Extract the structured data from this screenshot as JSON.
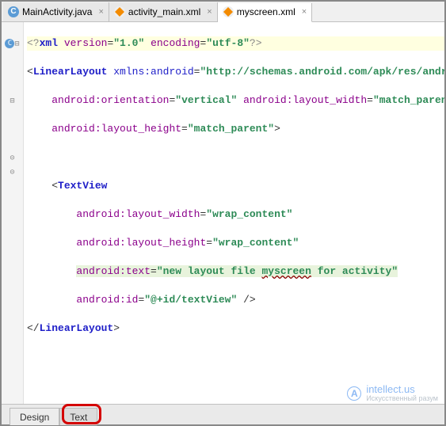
{
  "tabs": [
    {
      "label": "MainActivity.java",
      "icon_letter": "C",
      "icon_kind": "class",
      "active": false
    },
    {
      "label": "activity_main.xml",
      "icon_kind": "xml",
      "active": false
    },
    {
      "label": "myscreen.xml",
      "icon_kind": "xml",
      "active": true
    }
  ],
  "gutter": {
    "badge_letter": "C",
    "fold_open": "⊟",
    "fold_open2": "⊟",
    "fold_close": "⊝",
    "fold_close2": "⊝"
  },
  "code": {
    "l1": {
      "decl_open": "<?",
      "decl_name": "xml",
      "a1": "version",
      "v1": "\"1.0\"",
      "a2": "encoding",
      "v2": "\"utf-8\"",
      "decl_close": "?>"
    },
    "l2": {
      "open": "<",
      "tag": "LinearLayout",
      "a1": "xmlns:android",
      "v1": "\"http://schemas.android.com/apk/res/android\""
    },
    "l3": {
      "a1": "android:orientation",
      "v1": "\"vertical\"",
      "a2": "android:layout_width",
      "v2": "\"match_parent\""
    },
    "l4": {
      "a1": "android:layout_height",
      "v1": "\"match_parent\"",
      "close": ">"
    },
    "l6": {
      "open": "<",
      "tag": "TextView"
    },
    "l7": {
      "a1": "android:layout_width",
      "v1": "\"wrap_content\""
    },
    "l8": {
      "a1": "android:layout_height",
      "v1": "\"wrap_content\""
    },
    "l9": {
      "a1": "android:text",
      "vq": "\"",
      "vpre": "new layout file ",
      "vwarn": "myscreen",
      "vpost": " for activity",
      "vq2": "\""
    },
    "l10": {
      "a1": "android:id",
      "v1": "\"@+id/textView\"",
      "close": " />"
    },
    "l11": {
      "open": "</",
      "tag": "LinearLayout",
      "close": ">"
    }
  },
  "footer": {
    "design": "Design",
    "text": "Text"
  },
  "watermark": {
    "badge": "A",
    "title": "intellect.us",
    "subtitle": "Искусственный разум"
  }
}
